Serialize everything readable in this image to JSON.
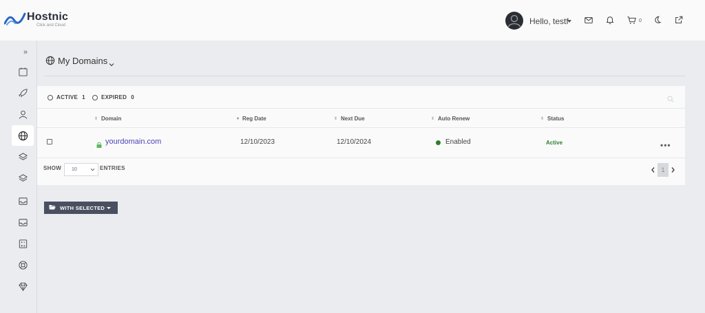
{
  "brand": {
    "name": "Hostnic",
    "tagline": "Click and Cloud"
  },
  "header": {
    "greeting": "Hello, testf",
    "cart_count": "0",
    "icons": [
      "avatar",
      "mail-icon",
      "bell-icon",
      "cart-icon",
      "moon-icon",
      "external-link-icon"
    ]
  },
  "sidebar": {
    "expand_label": "»",
    "items": [
      "calendar-icon",
      "rocket-icon",
      "user-icon",
      "globe-icon",
      "layers-icon",
      "layers-icon",
      "inbox-icon",
      "inbox-icon",
      "calculator-icon",
      "lifebuoy-icon",
      "diamond-icon"
    ],
    "active_index": 3
  },
  "page": {
    "title": "My Domains"
  },
  "filters": [
    {
      "label": "ACTIVE",
      "count": "1"
    },
    {
      "label": "EXPIRED",
      "count": "0"
    }
  ],
  "table": {
    "columns": [
      "Domain",
      "Reg Date",
      "Next Due",
      "Auto Renew",
      "Status"
    ],
    "rows": [
      {
        "domain": "yourdomain.com",
        "reg_date": "12/10/2023",
        "next_due": "12/10/2024",
        "auto_renew": "Enabled",
        "status": "Active",
        "actions": "•••"
      }
    ]
  },
  "pagination": {
    "show_label": "SHOW",
    "page_size": "10",
    "entries_label": "ENTRIES",
    "current_page": "1",
    "prev": "‹",
    "next": "›"
  },
  "bulk": {
    "label": "WITH SELECTED"
  },
  "colors": {
    "link": "#4a43b8",
    "success": "#2e7d32",
    "button": "#4a5060"
  }
}
